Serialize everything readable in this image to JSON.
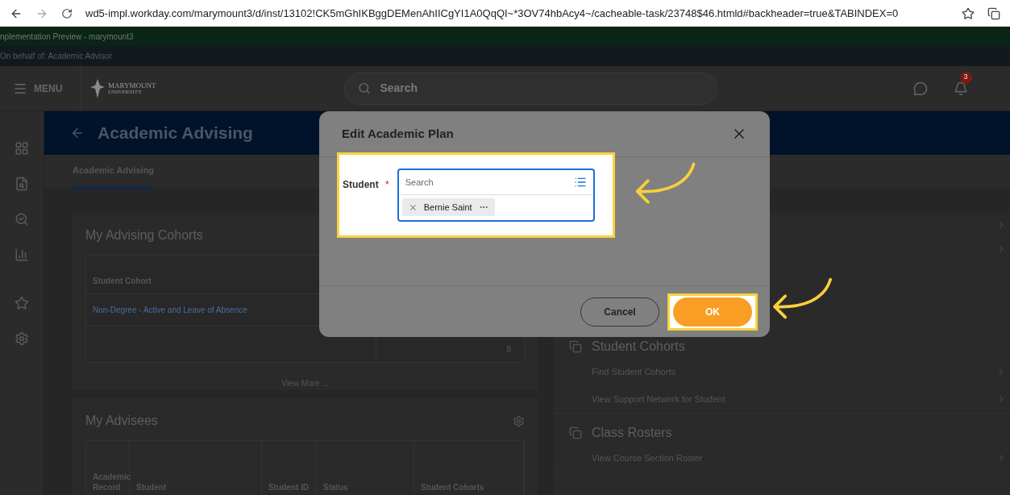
{
  "browser": {
    "url": "wd5-impl.workday.com/marymount3/d/inst/13102!CK5mGhIKBggDEMenAhIICgYI1A0QqQI~*3OV74hbAcy4~/cacheable-task/23748$46.htmld#backheader=true&TABINDEX=0"
  },
  "banner": "nplementation Preview - marymount3",
  "on_behalf": "On behalf of: Academic Advisor",
  "header": {
    "menu": "MENU",
    "logo_name": "MARYMOUNT",
    "logo_sub": "UNIVERSITY",
    "search_placeholder": "Search",
    "notification_count": "3"
  },
  "page": {
    "title": "Academic Advising",
    "tabs": [
      {
        "label": "Academic Advising",
        "selected": true
      }
    ]
  },
  "cohorts": {
    "title": "My Advising Cohorts",
    "column": "Student Cohort",
    "rows": [
      {
        "name": "Non-Degree - Active and Leave of Absence"
      }
    ],
    "count": "8",
    "view_more": "View More ..."
  },
  "advisees": {
    "title": "My Advisees",
    "columns": [
      "Academic Record",
      "Student",
      "Student ID",
      "Status",
      "Student Cohorts"
    ]
  },
  "sections": [
    {
      "title": "Student Cohorts",
      "items": [
        "Find Student Cohorts",
        "View Support Network for Student"
      ]
    },
    {
      "title": "Class Rosters",
      "items": [
        "View Course Section Roster"
      ]
    }
  ],
  "dialog": {
    "title": "Edit Academic Plan",
    "field": {
      "label": "Student",
      "required_mark": "*",
      "placeholder": "Search",
      "chips": [
        {
          "label": "Bernie Saint"
        }
      ]
    },
    "buttons": [
      {
        "label": "Cancel",
        "kind": "secondary",
        "highlighted": false
      },
      {
        "label": "OK",
        "kind": "primary",
        "highlighted": true
      }
    ]
  }
}
